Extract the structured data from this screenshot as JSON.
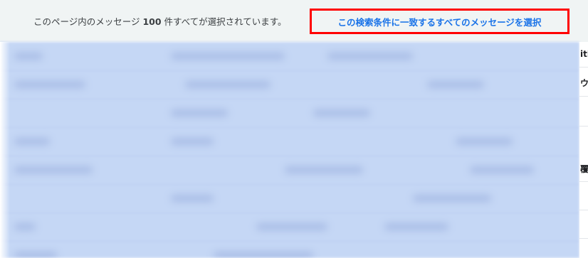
{
  "banner": {
    "message_pre": "このページ内のメッセージ ",
    "message_count": "100",
    "message_post": " 件すべてが選択されています。",
    "select_all_link": "この検索条件に一致するすべてのメッセージを選択"
  },
  "side_fragments": [
    "itl",
    "ウ",
    "覆"
  ],
  "colors": {
    "banner_bg": "#f0f4f4",
    "link": "#1a73e8",
    "highlight_box": "#ff0000",
    "selected_rows": "#c5d7f5"
  }
}
